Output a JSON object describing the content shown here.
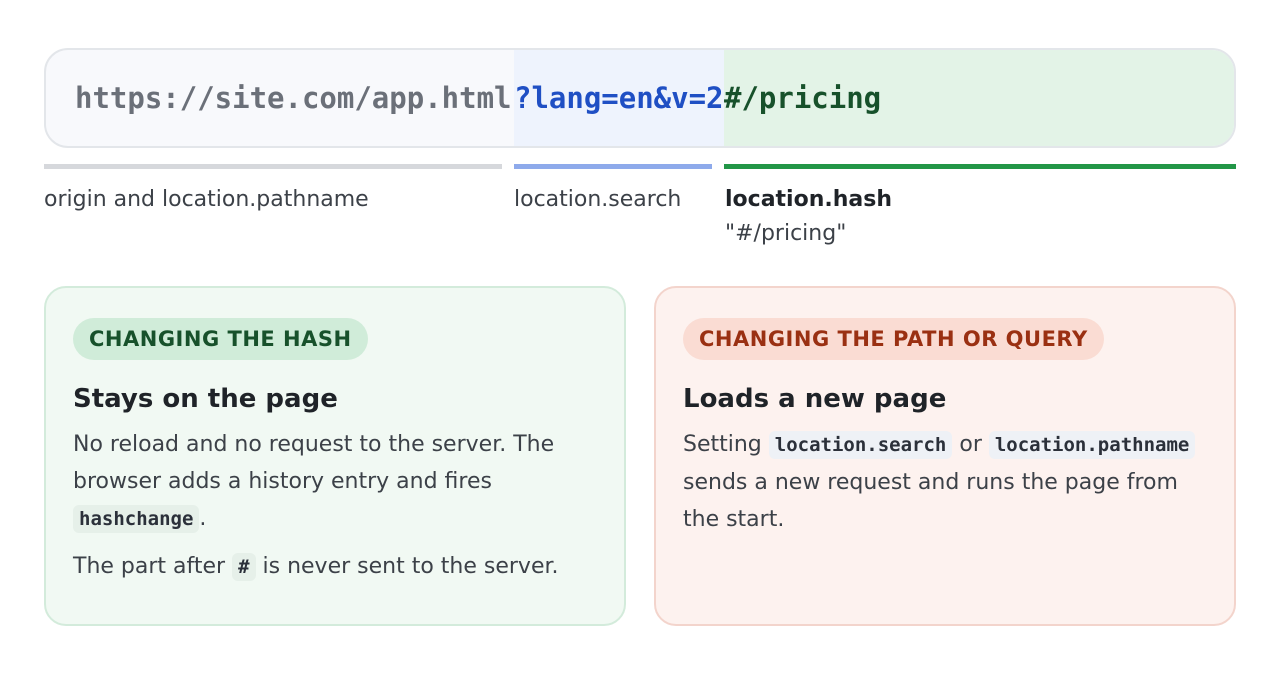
{
  "url": {
    "origin_path": "https://site.com/app.html",
    "search": "?lang=en&v=2",
    "hash": "#/pricing"
  },
  "labels": {
    "origin_path": "origin and location.pathname",
    "search": "location.search",
    "hash_name": "location.hash",
    "hash_value": "\"#/pricing\""
  },
  "cards": {
    "hash": {
      "badge": "CHANGING THE HASH",
      "title": "Stays on the page",
      "p1_text1": "No reload and no request to the server. The browser adds a history entry and fires ",
      "p1_code1": "hashchange",
      "p1_text2": ".",
      "p2_text1": "The part after ",
      "p2_code1": "#",
      "p2_text2": " is never sent to the server."
    },
    "path": {
      "badge": "CHANGING THE PATH OR QUERY",
      "title": "Loads a new page",
      "p1_text1": "Setting ",
      "p1_code1": "location.search",
      "p1_text2": " or ",
      "p1_code2": "location.pathname",
      "p1_text3": " sends a new request and runs the page from the start."
    }
  },
  "colors": {
    "search_text": "#1f4fc4",
    "hash_text": "#17512b",
    "hash_bar": "#229647",
    "search_bar": "#8eaaeb",
    "origin_bar": "#d6d8dc"
  }
}
